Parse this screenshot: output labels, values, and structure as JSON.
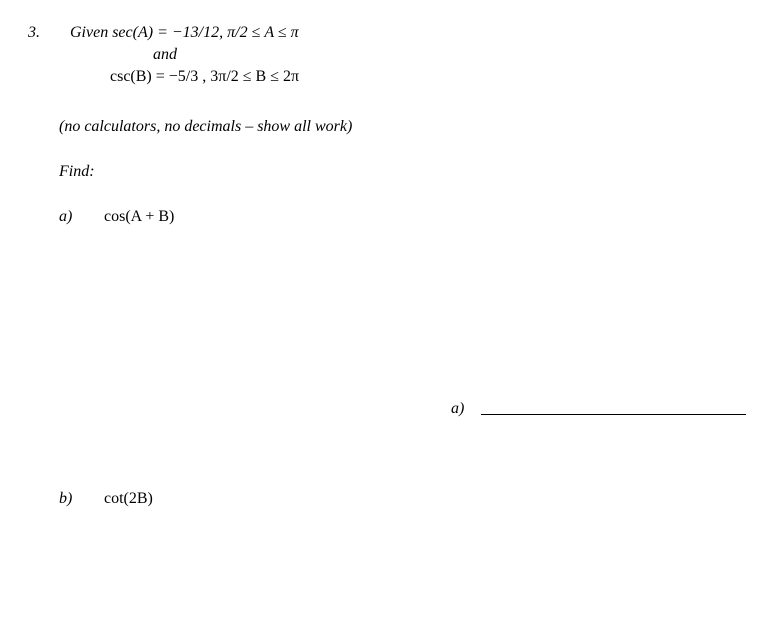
{
  "problem": {
    "number": "3.",
    "given_line1_prefix": "Given  ",
    "given_line1_math": "sec(A) = −13/12,  π/2 ≤ A ≤ π",
    "given_and": "and",
    "given_line2_math": "csc(B) =  −5/3 ,  3π/2 ≤ B ≤ 2π",
    "instruction": "(no calculators, no decimals – show all work)",
    "find_label": "Find:",
    "parts": {
      "a": {
        "label": "a)",
        "expression": "cos(A + B)",
        "answer_label": "a)"
      },
      "b": {
        "label": "b)",
        "expression": "cot(2B)"
      }
    }
  }
}
